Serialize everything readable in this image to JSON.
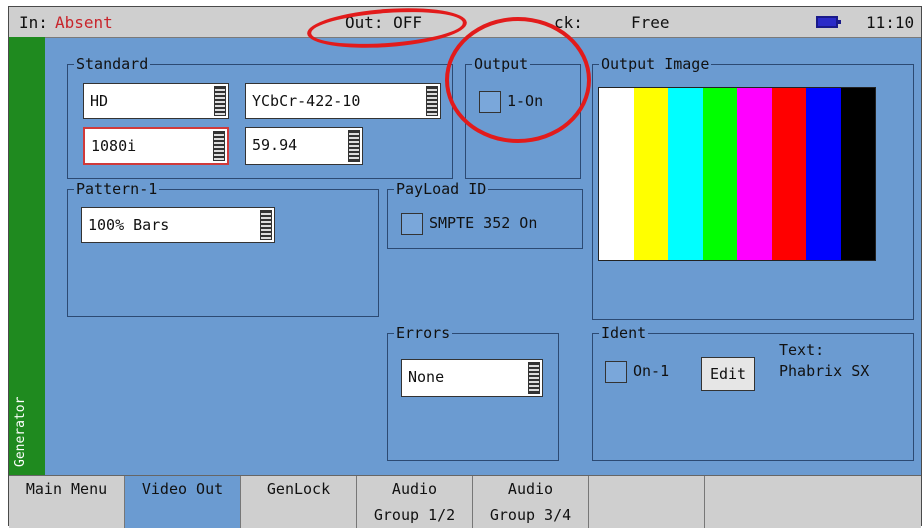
{
  "status": {
    "in_label": "In:",
    "in_value": "Absent",
    "out": "Out: OFF",
    "lock": "ck:",
    "lock_value": "Free",
    "time": "11:10"
  },
  "sidebar": {
    "label": "Generator"
  },
  "standard": {
    "title": "Standard",
    "format": "HD",
    "colorspace": "YCbCr-422-10",
    "resolution": "1080i",
    "rate": "59.94"
  },
  "output": {
    "title": "Output",
    "checkbox_label": "1-On"
  },
  "output_image": {
    "title": "Output Image",
    "bars": [
      "#ffffff",
      "#ffff00",
      "#00ffff",
      "#00ff00",
      "#ff00ff",
      "#ff0000",
      "#0000ff",
      "#000000"
    ]
  },
  "pattern": {
    "title": "Pattern-1",
    "value": "100% Bars"
  },
  "payload": {
    "title": "PayLoad ID",
    "checkbox_label": "SMPTE 352 On"
  },
  "errors": {
    "title": "Errors",
    "value": "None"
  },
  "ident": {
    "title": "Ident",
    "checkbox_label": "On-1",
    "edit_label": "Edit",
    "text_label": "Text:",
    "text_value": "Phabrix SX"
  },
  "tabs": [
    {
      "label": "Main Menu",
      "label2": ""
    },
    {
      "label": "Video Out",
      "label2": ""
    },
    {
      "label": "GenLock",
      "label2": ""
    },
    {
      "label": "Audio",
      "label2": "Group 1/2"
    },
    {
      "label": "Audio",
      "label2": "Group 3/4"
    }
  ],
  "colors": {
    "annotation": "#e21b1b",
    "screen_bg": "#6b9bd1",
    "side_tab": "#1f8a1f"
  }
}
